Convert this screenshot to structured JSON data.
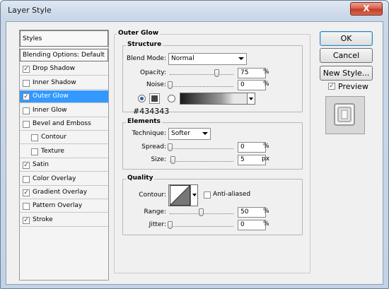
{
  "window": {
    "title": "Layer Style",
    "close_glyph": "X"
  },
  "styles_list": [
    {
      "label": "Styles",
      "type": "header"
    },
    {
      "label": "Blending Options: Default",
      "type": "header"
    },
    {
      "label": "Drop Shadow",
      "checked": true
    },
    {
      "label": "Inner Shadow",
      "checked": false
    },
    {
      "label": "Outer Glow",
      "checked": true,
      "selected": true
    },
    {
      "label": "Inner Glow",
      "checked": false
    },
    {
      "label": "Bevel and Emboss",
      "checked": false
    },
    {
      "label": "Contour",
      "checked": false,
      "indent": true
    },
    {
      "label": "Texture",
      "checked": false,
      "indent": true
    },
    {
      "label": "Satin",
      "checked": true
    },
    {
      "label": "Color Overlay",
      "checked": false
    },
    {
      "label": "Gradient Overlay",
      "checked": true
    },
    {
      "label": "Pattern Overlay",
      "checked": false
    },
    {
      "label": "Stroke",
      "checked": true
    }
  ],
  "panel": {
    "title": "Outer Glow",
    "structure": {
      "title": "Structure",
      "blend_mode_label": "Blend Mode:",
      "blend_mode": "Normal",
      "opacity_label": "Opacity:",
      "opacity": "75",
      "noise_label": "Noise:",
      "noise": "0",
      "percent": "%",
      "glow_color": "#434343",
      "color_hex_label": "#434343"
    },
    "elements": {
      "title": "Elements",
      "technique_label": "Technique:",
      "technique": "Softer",
      "spread_label": "Spread:",
      "spread": "0",
      "size_label": "Size:",
      "size": "5",
      "px": "px"
    },
    "quality": {
      "title": "Quality",
      "contour_label": "Contour:",
      "anti_aliased_label": "Anti-aliased",
      "range_label": "Range:",
      "range": "50",
      "jitter_label": "Jitter:",
      "jitter": "0"
    }
  },
  "buttons": {
    "ok": "OK",
    "cancel": "Cancel",
    "new_style": "New Style...",
    "preview_label": "Preview",
    "preview_checked": true
  }
}
